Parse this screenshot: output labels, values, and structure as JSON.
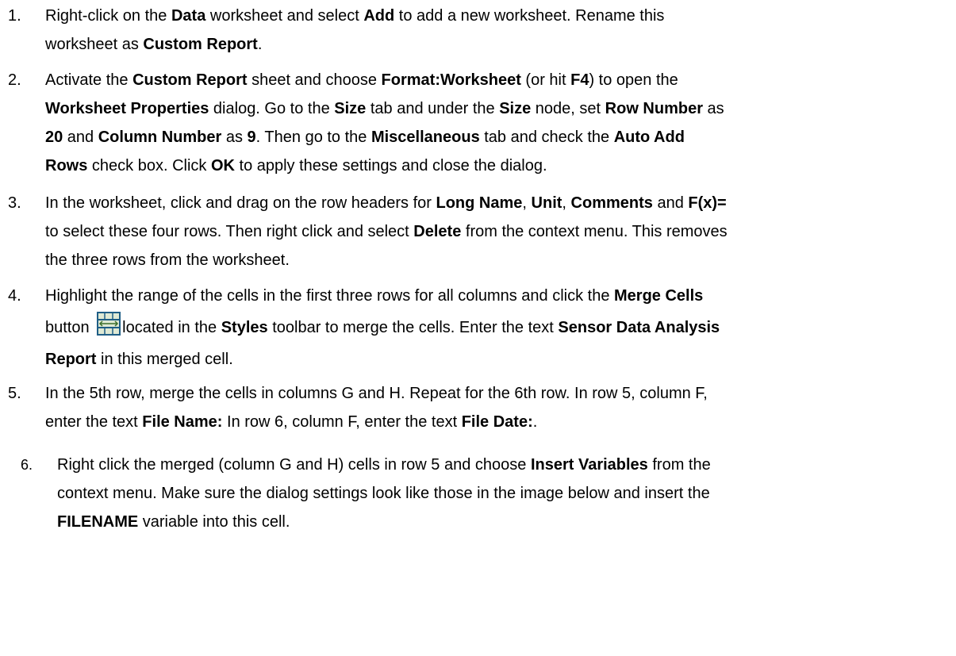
{
  "steps": [
    {
      "num": "1."
    },
    {
      "num": "2."
    },
    {
      "num": "3."
    },
    {
      "num": "4."
    },
    {
      "num": "5."
    },
    {
      "num": "6."
    }
  ],
  "t": {
    "s1a": "Right-click on the ",
    "s1b": "Data",
    "s1c": " worksheet and select ",
    "s1d": "Add",
    "s1e": " to add a new worksheet. Rename this",
    "s1f": "worksheet as ",
    "s1g": "Custom Report",
    "s1h": ".",
    "s2a": "Activate the ",
    "s2b": "Custom Report",
    "s2c": " sheet and choose ",
    "s2d": "Format:Worksheet",
    "s2e": " (or hit ",
    "s2f": "F4",
    "s2g": ") to open the",
    "s2h": "Worksheet Properties",
    "s2i": " dialog. Go to the ",
    "s2j": "Size",
    "s2k": " tab and under the ",
    "s2l": "Size",
    "s2m": " node, set ",
    "s2n": "Row Number",
    "s2o": " as",
    "s2p": "20",
    "s2q": " and ",
    "s2r": "Column Number",
    "s2s": " as ",
    "s2t": "9",
    "s2u": ". Then go to the ",
    "s2v": "Miscellaneous",
    "s2w": " tab and check the ",
    "s2x": "Auto Add",
    "s2y": "Rows",
    "s2z": " check box. Click ",
    "s2aa": "OK",
    "s2ab": " to apply these settings and close the dialog.",
    "s3a": "In the worksheet, click and drag on the row headers for ",
    "s3b": "Long Name",
    "s3c": ", ",
    "s3d": "Unit",
    "s3e": ", ",
    "s3f": "Comments",
    "s3g": " and ",
    "s3h": "F(x)=",
    "s3i": "to select these four rows. Then right click and select ",
    "s3j": "Delete",
    "s3k": " from the context menu. This removes",
    "s3l": "the three rows from the worksheet.",
    "s4a": "Highlight the range of the cells in the first three rows for all columns and click the ",
    "s4b": "Merge Cells",
    "s4c": "button ",
    "s4d": "located in the ",
    "s4e": "Styles",
    "s4f": " toolbar to merge the cells. Enter the text ",
    "s4g": "Sensor Data Analysis",
    "s4h": "Report",
    "s4i": " in this merged cell.",
    "s5a": "In the 5th row, merge the cells in columns G and H. Repeat for the 6th row. In row 5, column F,",
    "s5b": "enter the text ",
    "s5c": "File Name:",
    "s5d": " In row 6, column F, enter the text ",
    "s5e": "File Date:",
    "s5f": ".",
    "s6a": "Right click the merged (column G and H) cells in row 5 and choose ",
    "s6b": "Insert Variables",
    "s6c": " from the",
    "s6d": "context menu. Make sure the dialog settings look like those in the image below and insert the",
    "s6e": "FILENAME",
    "s6f": " variable into this cell."
  },
  "icons": {
    "merge_cells": "merge-cells-icon"
  },
  "colors": {
    "icon_frame": "#1f5e86",
    "icon_fill": "#dfe9d4",
    "icon_arrows": "#3b6e2a"
  }
}
